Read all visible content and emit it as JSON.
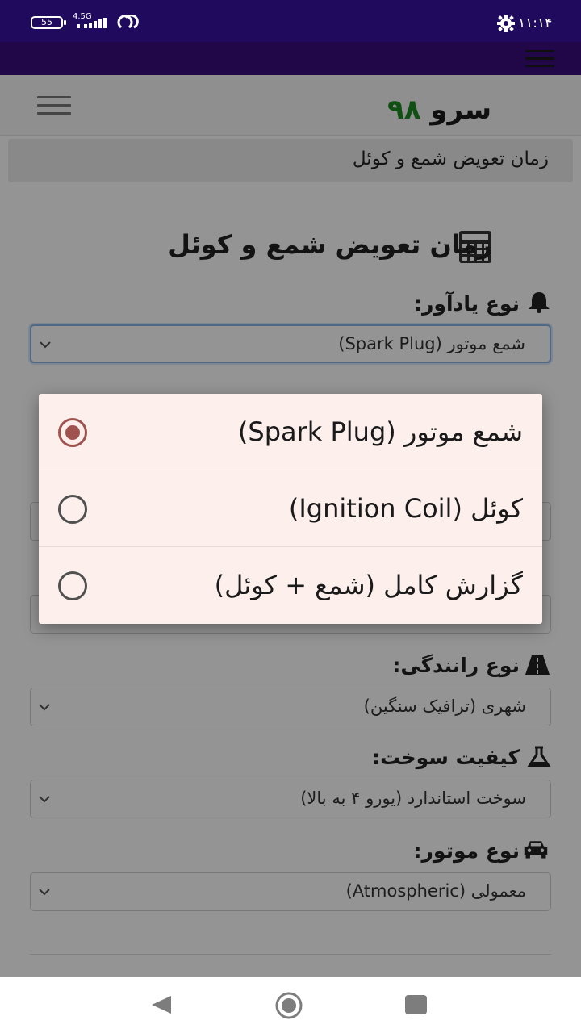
{
  "status_bar": {
    "battery": "55",
    "network": "4.5G",
    "time": "۱۱:۱۴",
    "icons": [
      "battery-icon",
      "signal-icon",
      "hotspot-icon",
      "settings-gear-icon"
    ]
  },
  "header": {
    "brand_word": "سرو",
    "brand_number": "۹۸",
    "menu_icon": "hamburger-icon"
  },
  "breadcrumb": "زمان تعویض شمع و کوئل",
  "page_title": "زمان تعویض شمع و کوئل",
  "form": {
    "reminder_type": {
      "label": "نوع یادآور:",
      "value": "شمع موتور (Spark Plug)",
      "icon": "bell-icon"
    },
    "driving_type": {
      "label": "نوع رانندگی:",
      "value": "شهری (ترافیک سنگین)",
      "icon": "road-icon"
    },
    "fuel_quality": {
      "label": "کیفیت سوخت:",
      "value": "سوخت استاندارد (یورو ۴ به بالا)",
      "icon": "flask-icon"
    },
    "engine_type": {
      "label": "نوع موتور:",
      "value": "معمولی (Atmospheric)",
      "icon": "car-icon"
    }
  },
  "dialog": {
    "options": [
      {
        "label": "شمع موتور (Spark Plug)",
        "selected": true
      },
      {
        "label": "کوئل (Ignition Coil)",
        "selected": false
      },
      {
        "label": "گزارش کامل (شمع + کوئل)",
        "selected": false
      }
    ]
  },
  "colors": {
    "status_bar": "#1f0a5e",
    "app_bar": "#3a0d7c",
    "brand_number": "#1e8b22",
    "dialog_bg": "#fcefec",
    "radio_selected": "#a0524e"
  },
  "navigation": [
    "back-icon",
    "home-icon",
    "recents-icon"
  ]
}
